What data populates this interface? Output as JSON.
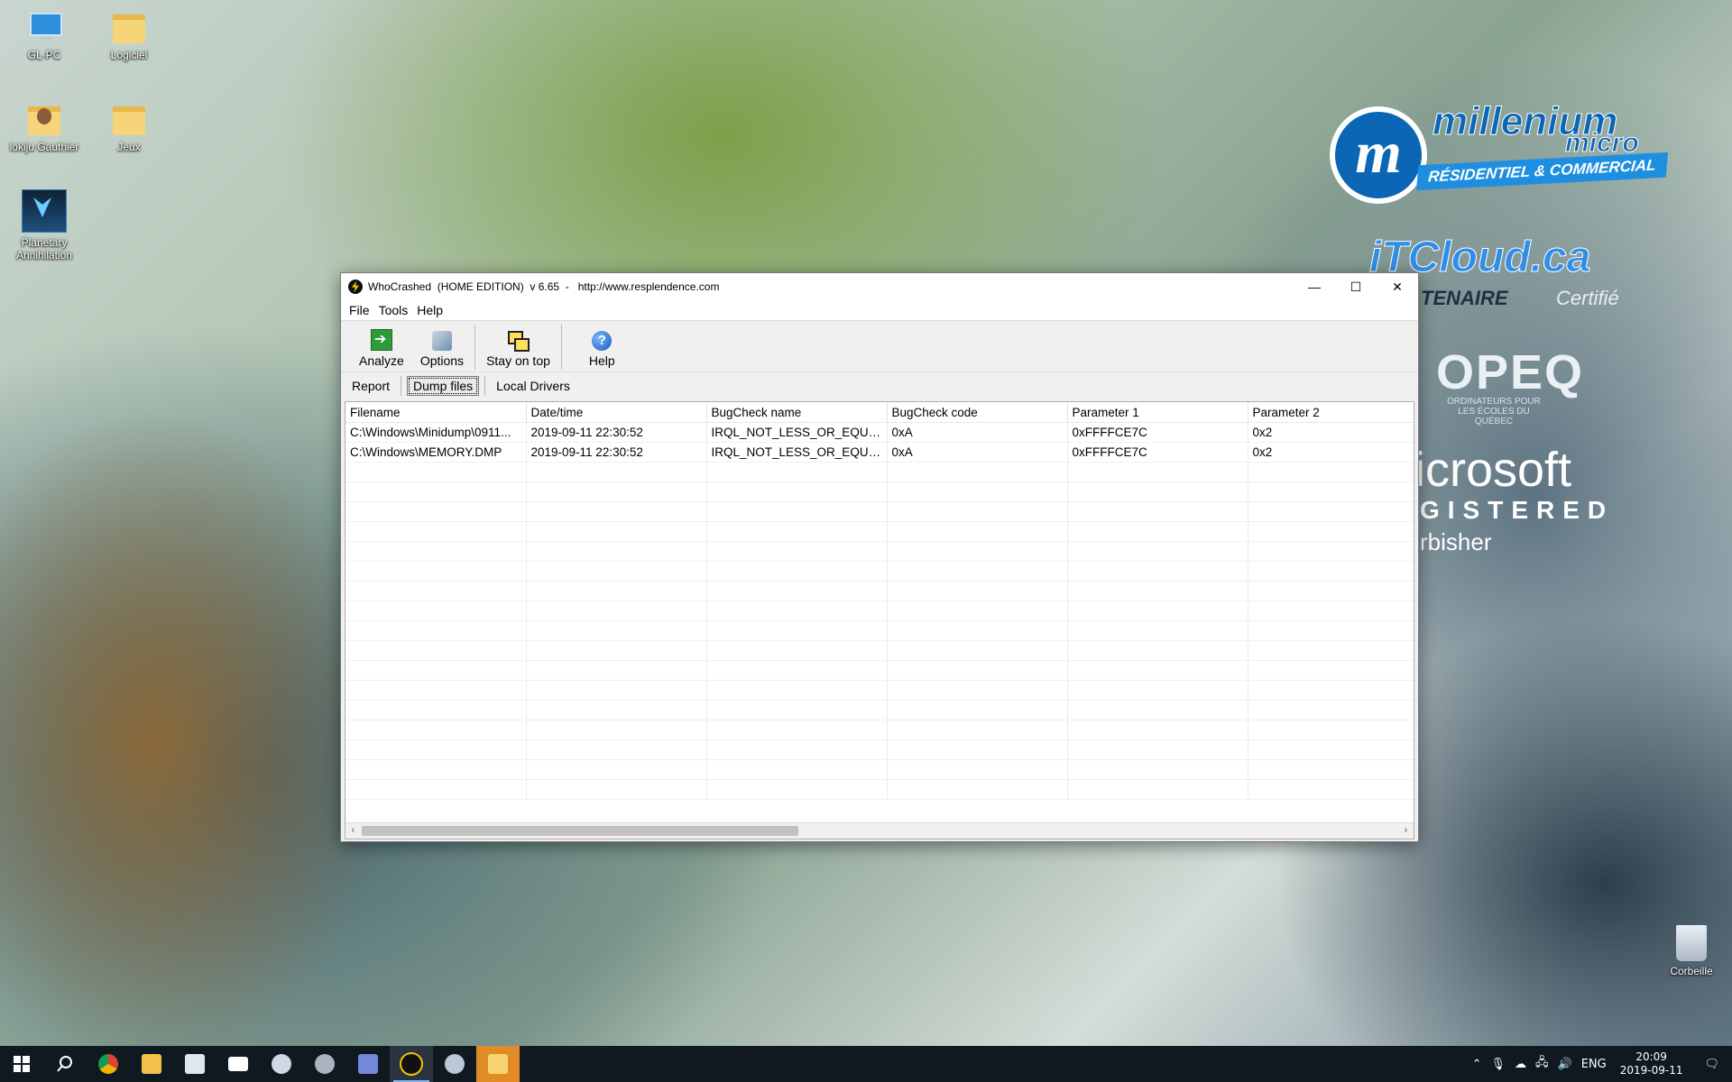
{
  "desktop": {
    "icons": [
      {
        "label": "GL-PC"
      },
      {
        "label": "Logiciel"
      },
      {
        "label": "lokiju Gauthier"
      },
      {
        "label": "Jeux"
      },
      {
        "label": "Planetary Annihilation"
      }
    ],
    "recycle_bin": {
      "label": "Corbeille"
    },
    "wallpaper_branding": {
      "millenium_mark": "m",
      "millenium": "millenium",
      "micro": "micro",
      "banner": "RÉSIDENTIEL & COMMERCIAL",
      "itcloud": "iTCloud.ca",
      "partenaire": "TENAIRE",
      "certifie": "Certifié",
      "opeq": "OPEQ",
      "opeq_sub": "ORDINATEURS POUR LES ÉCOLES DU QUÉBEC",
      "microsoft": "icrosoft",
      "registered": "GISTERED",
      "refurbisher": "rbisher"
    }
  },
  "window": {
    "title": "WhoCrashed  (HOME EDITION)  v 6.65  -   http://www.resplendence.com",
    "controls": {
      "minimize": "—",
      "maximize": "☐",
      "close": "✕"
    },
    "menu": [
      {
        "label": "File"
      },
      {
        "label": "Tools"
      },
      {
        "label": "Help"
      }
    ],
    "toolbar": [
      {
        "label": "Analyze",
        "icon": "analyze-icon"
      },
      {
        "label": "Options",
        "icon": "options-icon"
      },
      {
        "label": "Stay on top",
        "icon": "stay-on-top-icon"
      },
      {
        "label": "Help",
        "icon": "help-icon"
      }
    ],
    "tabs": [
      {
        "label": "Report",
        "active": false
      },
      {
        "label": "Dump files",
        "active": true
      },
      {
        "label": "Local Drivers",
        "active": false
      }
    ],
    "table": {
      "columns": [
        "Filename",
        "Date/time",
        "BugCheck name",
        "BugCheck code",
        "Parameter 1",
        "Parameter 2"
      ],
      "rows": [
        [
          "C:\\Windows\\Minidump\\0911...",
          "2019-09-11 22:30:52",
          "IRQL_NOT_LESS_OR_EQUAL",
          "0xA",
          "0xFFFFCE7C",
          "0x2"
        ],
        [
          "C:\\Windows\\MEMORY.DMP",
          "2019-09-11 22:30:52",
          "IRQL_NOT_LESS_OR_EQUAL",
          "0xA",
          "0xFFFFCE7C",
          "0x2"
        ]
      ]
    },
    "scrollbar": {
      "left_arrow": "‹",
      "right_arrow": "›"
    }
  },
  "taskbar": {
    "apps": [
      "start",
      "search",
      "chrome",
      "file-explorer",
      "store",
      "mail",
      "steam",
      "app",
      "discord",
      "whocrashed",
      "paint",
      "folder-active"
    ],
    "tray": {
      "language": "ENG",
      "time": "20:09",
      "date": "2019-09-11"
    }
  },
  "colors": {
    "accent": "#0b67b5",
    "taskbar": "#101820",
    "window_bg": "#f0f0f0"
  }
}
